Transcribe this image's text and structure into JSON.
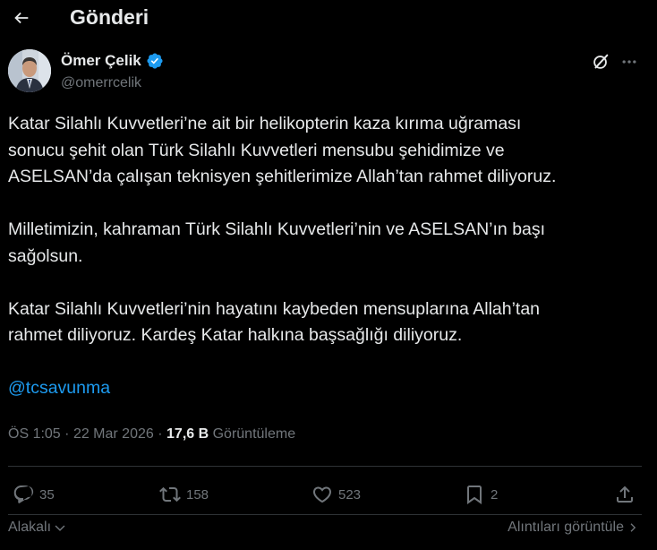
{
  "header": {
    "title": "Gönderi",
    "back_icon": "arrow-left-icon"
  },
  "post": {
    "author": {
      "name": "Ömer Çelik",
      "handle": "@omerrcelik",
      "verified": true
    },
    "paragraphs": [
      [
        "Katar Silahlı Kuvvetleri’ne ait bir helikopterin kaza kırıma uğraması",
        "sonucu şehit olan Türk Silahlı Kuvvetleri mensubu şehidimize ve",
        "ASELSAN’da çalışan teknisyen şehitlerimize  Allah’tan rahmet diliyoruz."
      ],
      [
        "Milletimizin, kahraman Türk Silahlı Kuvvetleri’nin ve ASELSAN’ın başı",
        "sağolsun."
      ],
      [
        "Katar Silahlı Kuvvetleri’nin hayatını kaybeden mensuplarına Allah’tan",
        "rahmet diliyoruz. Kardeş Katar halkına başsağlığı diliyoruz."
      ]
    ],
    "mention": "@tcsavunma",
    "time": "ÖS 1:05",
    "date": "22 Mar 2026",
    "separator": "·",
    "views_count": "17,6 B",
    "views_label": "Görüntüleme"
  },
  "actions": {
    "replies": "35",
    "reposts": "158",
    "likes": "523",
    "bookmarks": "2"
  },
  "footer": {
    "sort_label": "Alakalı",
    "view_quotes_label": "Alıntıları görüntüle"
  },
  "colors": {
    "background": "#000000",
    "text": "#e7e9ea",
    "muted": "#71767b",
    "accent": "#1d9bf0",
    "divider": "#2f3336"
  }
}
